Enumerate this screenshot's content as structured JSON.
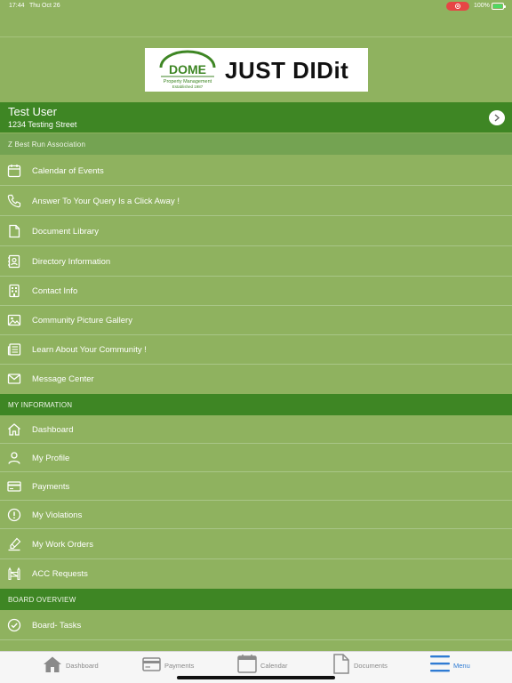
{
  "status_bar": {
    "time": "17:44",
    "date": "Thu Oct 26",
    "battery": "100%",
    "record_color": "#e64545"
  },
  "logo": {
    "mark_word": "DOME",
    "mark_sub1": "Property Management",
    "mark_sub2": "Established 1987",
    "text": "JUST DIDit"
  },
  "user": {
    "name": "Test User",
    "address": "1234 Testing Street"
  },
  "association": "Z Best Run Association",
  "association_items": [
    {
      "icon": "calendar-icon",
      "label": "Calendar of Events"
    },
    {
      "icon": "phone-icon",
      "label": "Answer To Your Query Is a Click Away !"
    },
    {
      "icon": "document-icon",
      "label": "Document Library"
    },
    {
      "icon": "contact-card-icon",
      "label": "Directory Information"
    },
    {
      "icon": "building-icon",
      "label": "Contact Info"
    },
    {
      "icon": "image-icon",
      "label": "Community Picture Gallery"
    },
    {
      "icon": "newspaper-icon",
      "label": "Learn About Your Community !"
    },
    {
      "icon": "envelope-icon",
      "label": "Message Center"
    }
  ],
  "my_information": {
    "title": "MY INFORMATION",
    "items": [
      {
        "icon": "home-icon",
        "label": "Dashboard"
      },
      {
        "icon": "person-icon",
        "label": "My Profile"
      },
      {
        "icon": "credit-card-icon",
        "label": "Payments"
      },
      {
        "icon": "alert-circle-icon",
        "label": "My Violations"
      },
      {
        "icon": "tools-icon",
        "label": "My Work Orders"
      },
      {
        "icon": "fence-icon",
        "label": "ACC Requests"
      }
    ]
  },
  "board_overview": {
    "title": "BOARD OVERVIEW",
    "items": [
      {
        "icon": "check-circle-icon",
        "label": "Board- Tasks"
      }
    ]
  },
  "tabs": [
    {
      "icon": "home-icon",
      "label": "Dashboard",
      "active": false
    },
    {
      "icon": "credit-card-icon",
      "label": "Payments",
      "active": false
    },
    {
      "icon": "calendar-icon",
      "label": "Calendar",
      "active": false
    },
    {
      "icon": "document-icon",
      "label": "Documents",
      "active": false
    },
    {
      "icon": "menu-icon",
      "label": "Menu",
      "active": true
    }
  ],
  "colors": {
    "background": "#8fb25f",
    "header_dark": "#3e8624",
    "section_light": "#74a352",
    "tab_active": "#2f7bd3",
    "logo_green": "#3e8624"
  }
}
